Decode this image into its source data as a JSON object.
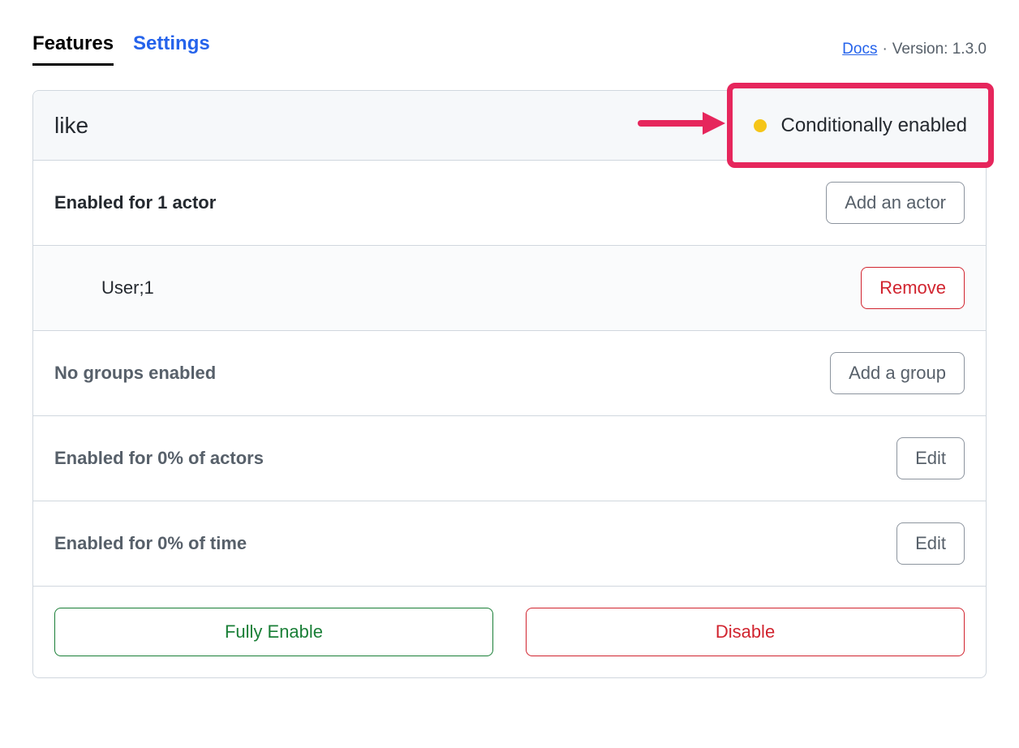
{
  "nav": {
    "tabs": {
      "features": "Features",
      "settings": "Settings"
    },
    "docs": "Docs",
    "separator": "·",
    "version": "Version: 1.3.0"
  },
  "feature": {
    "name": "like",
    "status": "Conditionally enabled"
  },
  "sections": {
    "actors": {
      "label": "Enabled for 1 actor",
      "add_button": "Add an actor",
      "items": [
        {
          "name": "User;1",
          "remove_button": "Remove"
        }
      ]
    },
    "groups": {
      "label": "No groups enabled",
      "add_button": "Add a group"
    },
    "pct_actors": {
      "label": "Enabled for 0% of actors",
      "edit_button": "Edit"
    },
    "pct_time": {
      "label": "Enabled for 0% of time",
      "edit_button": "Edit"
    }
  },
  "footer": {
    "enable": "Fully Enable",
    "disable": "Disable"
  }
}
